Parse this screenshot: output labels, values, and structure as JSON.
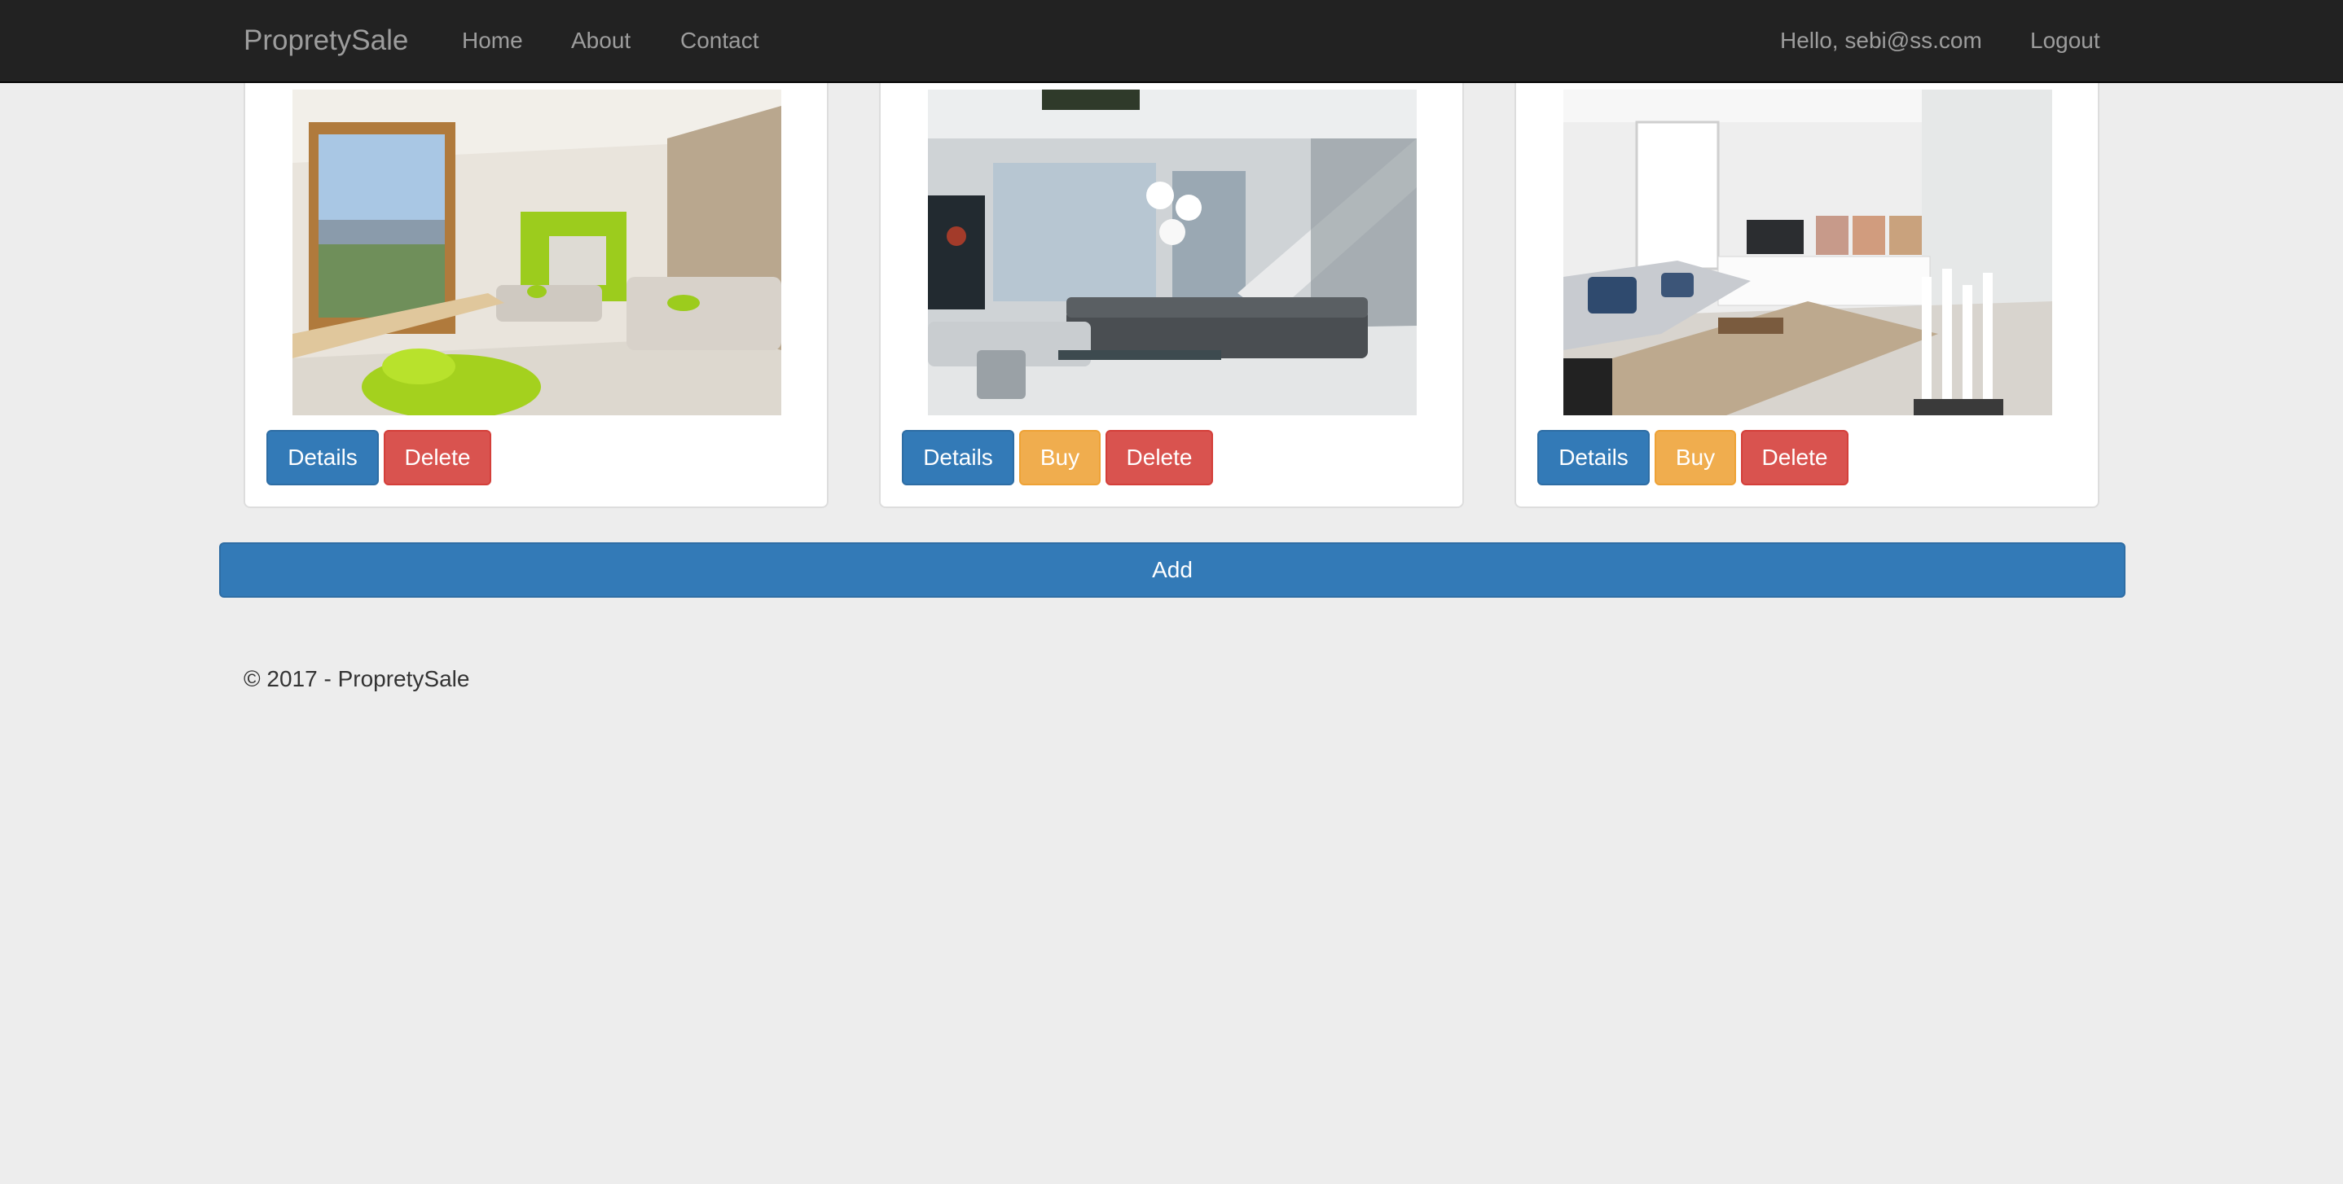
{
  "navbar": {
    "brand": "PropretySale",
    "links": [
      {
        "label": "Home"
      },
      {
        "label": "About"
      },
      {
        "label": "Contact"
      }
    ],
    "greeting": "Hello, sebi@ss.com",
    "logout": "Logout",
    "background": "#222222"
  },
  "properties": [
    {
      "buttons": {
        "details": "Details",
        "delete": "Delete"
      }
    },
    {
      "buttons": {
        "details": "Details",
        "buy": "Buy",
        "delete": "Delete"
      }
    },
    {
      "buttons": {
        "details": "Details",
        "buy": "Buy",
        "delete": "Delete"
      }
    }
  ],
  "add_button": "Add",
  "footer": "© 2017 - PropretySale",
  "colors": {
    "primary": "#337ab7",
    "danger": "#d9534f",
    "warning": "#f0ad4e",
    "page_bg": "#ededed"
  }
}
